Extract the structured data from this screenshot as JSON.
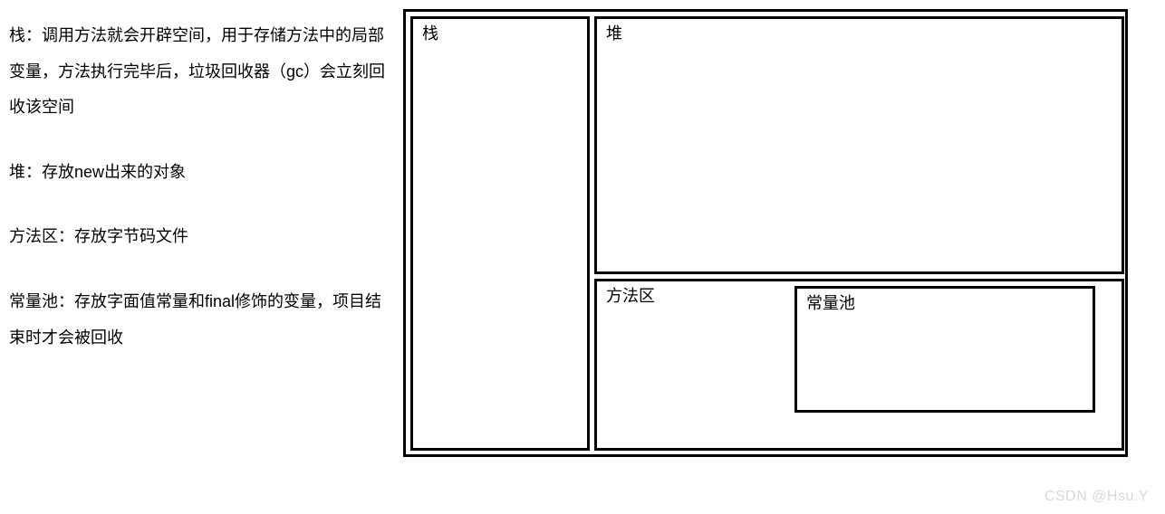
{
  "descriptions": {
    "stack": "栈：调用方法就会开辟空间，用于存储方法中的局部变量，方法执行完毕后，垃圾回收器（gc）会立刻回收该空间",
    "heap": "堆：存放new出来的对象",
    "method_area": "方法区：存放字节码文件",
    "constant_pool": "常量池：存放字面值常量和final修饰的变量，项目结束时才会被回收"
  },
  "diagram": {
    "stack_label": "栈",
    "heap_label": "堆",
    "method_area_label": "方法区",
    "constant_pool_label": "常量池"
  },
  "watermark": "CSDN @Hsu.Y"
}
